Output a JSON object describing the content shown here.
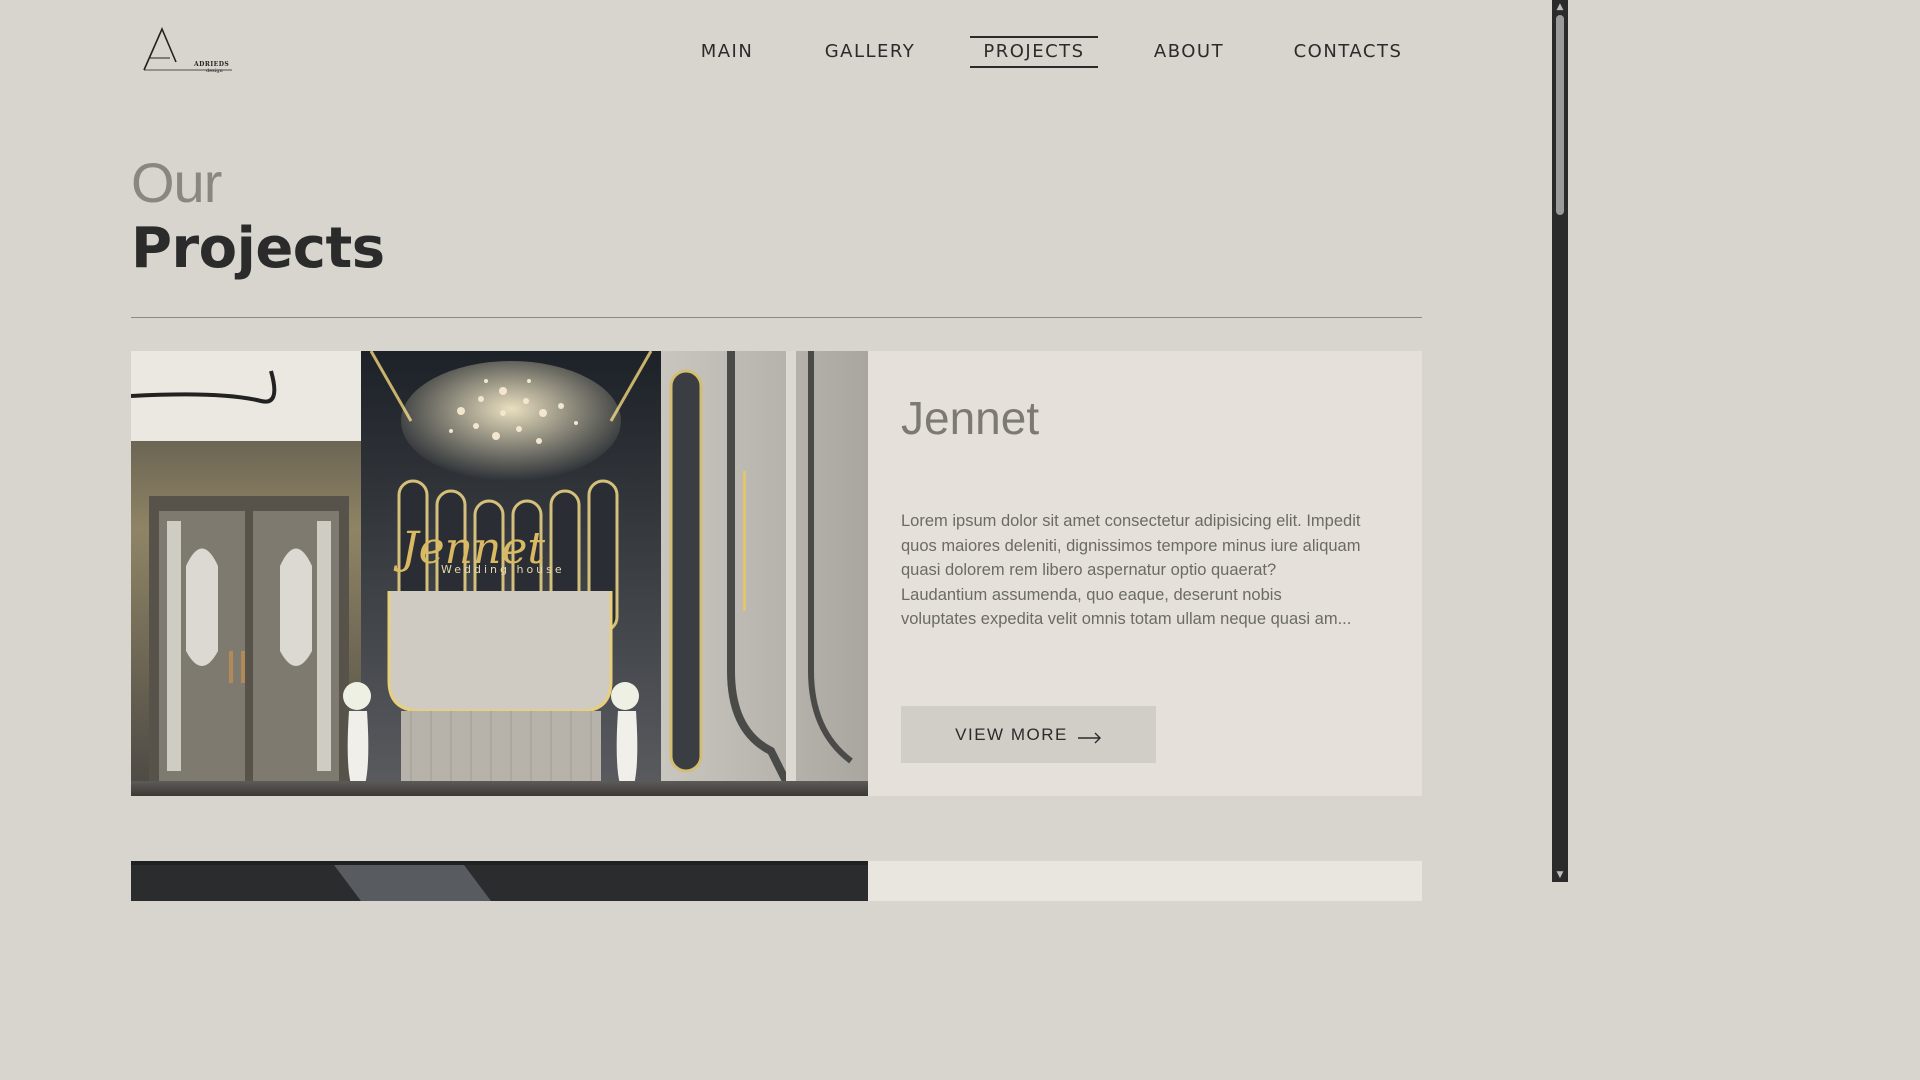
{
  "logo": {
    "brand": "ADRIEDS",
    "sub": "design"
  },
  "nav": [
    {
      "label": "MAIN",
      "active": false
    },
    {
      "label": "GALLERY",
      "active": false
    },
    {
      "label": "PROJECTS",
      "active": true
    },
    {
      "label": "ABOUT",
      "active": false
    },
    {
      "label": "CONTACTS",
      "active": false
    }
  ],
  "heading": {
    "light": "Our",
    "bold": "Projects"
  },
  "projects": [
    {
      "title": "Jennet",
      "image_sign": "Jennet",
      "image_sign_sub": "Wedding house",
      "description": "Lorem ipsum dolor sit amet consectetur adipisicing elit. Impedit quos maiores deleniti, dignissimos tempore minus iure aliquam quasi dolorem rem libero aspernatur optio quaerat? Laudantium assumenda, quo eaque, deserunt nobis voluptates expedita velit omnis totam ullam neque quasi am...",
      "button_label": "VIEW MORE"
    }
  ],
  "icons": {
    "arrow": "arrow-right-icon",
    "scroll_up": "triangle-up-icon",
    "scroll_down": "triangle-down-icon"
  },
  "colors": {
    "background": "#d8d5ce",
    "card": "#e5e1da",
    "button": "#d1cec7",
    "text": "#2b2b2b"
  }
}
